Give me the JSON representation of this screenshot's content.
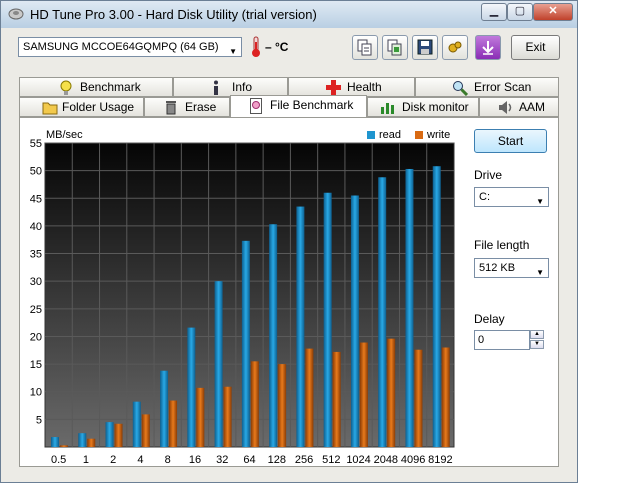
{
  "window": {
    "title": "HD Tune Pro 3.00 - Hard Disk Utility (trial version)"
  },
  "toolbar": {
    "drive": "SAMSUNG MCCOE64GQMPQ (64 GB)",
    "temperature": "– °C",
    "exit_label": "Exit",
    "buttons": [
      "copy-text-icon",
      "copy-screen-icon",
      "save-icon",
      "options-icon",
      "download-icon"
    ]
  },
  "tabs": {
    "row1": [
      "Benchmark",
      "Info",
      "Health",
      "Error Scan"
    ],
    "row2": [
      "Folder Usage",
      "Erase",
      "File Benchmark",
      "Disk monitor",
      "AAM"
    ],
    "active": "File Benchmark"
  },
  "controls": {
    "start_label": "Start",
    "drive_label": "Drive",
    "drive_value": "C:",
    "file_length_label": "File length",
    "file_length_value": "512 KB",
    "delay_label": "Delay",
    "delay_value": "0"
  },
  "colors": {
    "read": "#1f95cf",
    "write": "#d96a12"
  },
  "chart_data": {
    "type": "bar",
    "ylabel": "MB/sec",
    "ylim": [
      0,
      55
    ],
    "yticks": [
      5,
      10,
      15,
      20,
      25,
      30,
      35,
      40,
      45,
      50,
      55
    ],
    "categories": [
      "0.5",
      "1",
      "2",
      "4",
      "8",
      "16",
      "32",
      "64",
      "128",
      "256",
      "512",
      "1024",
      "2048",
      "4096",
      "8192"
    ],
    "series": [
      {
        "name": "read",
        "values": [
          1.8,
          2.5,
          4.5,
          8.2,
          13.8,
          21.6,
          30.0,
          37.3,
          40.3,
          43.5,
          46.0,
          45.5,
          48.8,
          50.3,
          50.8
        ]
      },
      {
        "name": "write",
        "values": [
          0.3,
          1.5,
          4.2,
          5.9,
          8.4,
          10.7,
          10.9,
          15.5,
          15.0,
          17.8,
          17.2,
          18.9,
          19.6,
          17.6,
          18.0
        ]
      }
    ],
    "legend_position": "top-right",
    "grid": true
  }
}
